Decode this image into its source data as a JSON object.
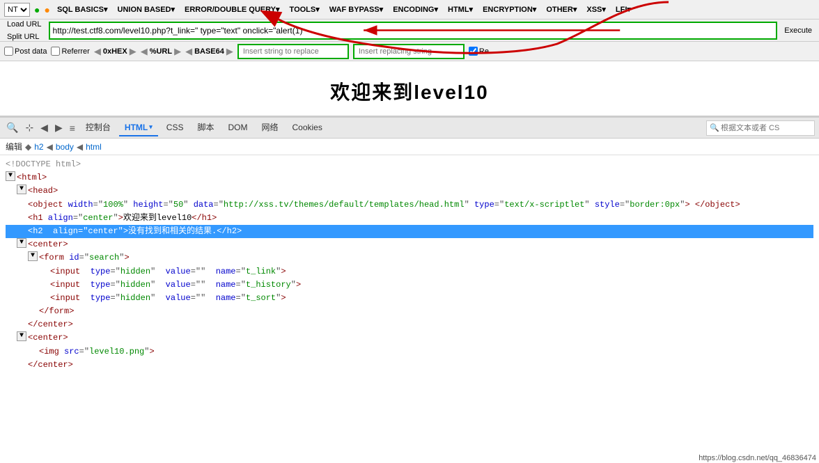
{
  "toolbar": {
    "dropdown_label": "NT",
    "menus": [
      {
        "label": "SQL BASICS▾",
        "id": "sql-basics"
      },
      {
        "label": "UNION BASED▾",
        "id": "union-based"
      },
      {
        "label": "ERROR/DOUBLE QUERY▾",
        "id": "error-double"
      },
      {
        "label": "TOOLS▾",
        "id": "tools"
      },
      {
        "label": "WAF BYPASS▾",
        "id": "waf-bypass"
      },
      {
        "label": "ENCODING▾",
        "id": "encoding"
      },
      {
        "label": "HTML▾",
        "id": "html"
      },
      {
        "label": "ENCRYPTION▾",
        "id": "encryption"
      },
      {
        "label": "OTHER▾",
        "id": "other"
      },
      {
        "label": "XSS▾",
        "id": "xss"
      },
      {
        "label": "LFI▾",
        "id": "lfi"
      }
    ]
  },
  "url_row": {
    "load_url": "Load URL",
    "split_url": "Split URL",
    "execute": "Execute",
    "url_value": "http://test.ctf8.com/level10.php?t_link=\" type=\"text\" onclick=\"alert(1)"
  },
  "encode_row": {
    "post_data": "Post data",
    "referrer": "Referrer",
    "hex": "0xHEX",
    "url": "%URL",
    "base64": "BASE64",
    "insert_replace": "Insert string to replace",
    "insert_replacing": "Insert replacing string",
    "re_checkbox": "Re"
  },
  "welcome": {
    "text": "欢迎来到level10"
  },
  "devtools": {
    "icons": [
      "◀",
      "▶",
      "≡"
    ],
    "tabs": [
      {
        "label": "控制台",
        "active": false
      },
      {
        "label": "HTML",
        "active": true,
        "dropdown": true
      },
      {
        "label": "CSS",
        "active": false
      },
      {
        "label": "脚本",
        "active": false
      },
      {
        "label": "DOM",
        "active": false
      },
      {
        "label": "网络",
        "active": false
      },
      {
        "label": "Cookies",
        "active": false
      }
    ],
    "search_placeholder": "根据文本或者 CS",
    "breadcrumb": {
      "edit": "编辑",
      "items": [
        "h2",
        "body",
        "html"
      ]
    },
    "code_lines": [
      {
        "id": "l1",
        "indent": 0,
        "content": "<!DOCTYPE html>",
        "type": "comment",
        "selected": false
      },
      {
        "id": "l2",
        "indent": 0,
        "content": "<html>",
        "type": "tag",
        "selected": false,
        "expandable": true,
        "expanded": true
      },
      {
        "id": "l3",
        "indent": 1,
        "content": "<head>",
        "type": "tag",
        "selected": false,
        "expandable": true,
        "expanded": true
      },
      {
        "id": "l4",
        "indent": 2,
        "content": "<object width=\"100%\" height=\"50\" data=\"http://xss.tv/themes/default/templates/head.html\" type=\"text/x-scriptlet\" style=\"border:0px\"> </object>",
        "type": "mixed",
        "selected": false
      },
      {
        "id": "l5",
        "indent": 2,
        "content": "<h1 align=\"center\">欢迎来到level10</h1>",
        "type": "mixed",
        "selected": false
      },
      {
        "id": "l6",
        "indent": 2,
        "content": "<h2 align=\"center\">没有找到和相关的结果.</h2>",
        "type": "mixed",
        "selected": true
      },
      {
        "id": "l7",
        "indent": 1,
        "content": "<center>",
        "type": "tag",
        "selected": false,
        "expandable": true,
        "expanded": true
      },
      {
        "id": "l8",
        "indent": 2,
        "content": "<form id=\"search\">",
        "type": "tag",
        "selected": false,
        "expandable": true,
        "expanded": true
      },
      {
        "id": "l9",
        "indent": 3,
        "content": "<input  type=\"hidden\"  value=\"\"  name=\"t_link\">",
        "type": "mixed",
        "selected": false
      },
      {
        "id": "l10",
        "indent": 3,
        "content": "<input  type=\"hidden\"  value=\"\"  name=\"t_history\">",
        "type": "mixed",
        "selected": false
      },
      {
        "id": "l11",
        "indent": 3,
        "content": "<input  type=\"hidden\"  value=\"\"  name=\"t_sort\">",
        "type": "mixed",
        "selected": false
      },
      {
        "id": "l12",
        "indent": 2,
        "content": "</form>",
        "type": "tag",
        "selected": false
      },
      {
        "id": "l13",
        "indent": 1,
        "content": "</center>",
        "type": "tag",
        "selected": false
      },
      {
        "id": "l14",
        "indent": 1,
        "content": "<center>",
        "type": "tag",
        "selected": false,
        "expandable": true,
        "expanded": true
      },
      {
        "id": "l15",
        "indent": 2,
        "content": "<img src=\"level10.png\">",
        "type": "mixed",
        "selected": false
      },
      {
        "id": "l16",
        "indent": 1,
        "content": "</center>",
        "type": "tag",
        "selected": false
      }
    ]
  },
  "footer": {
    "url": "https://blog.csdn.net/qq_46836474"
  }
}
